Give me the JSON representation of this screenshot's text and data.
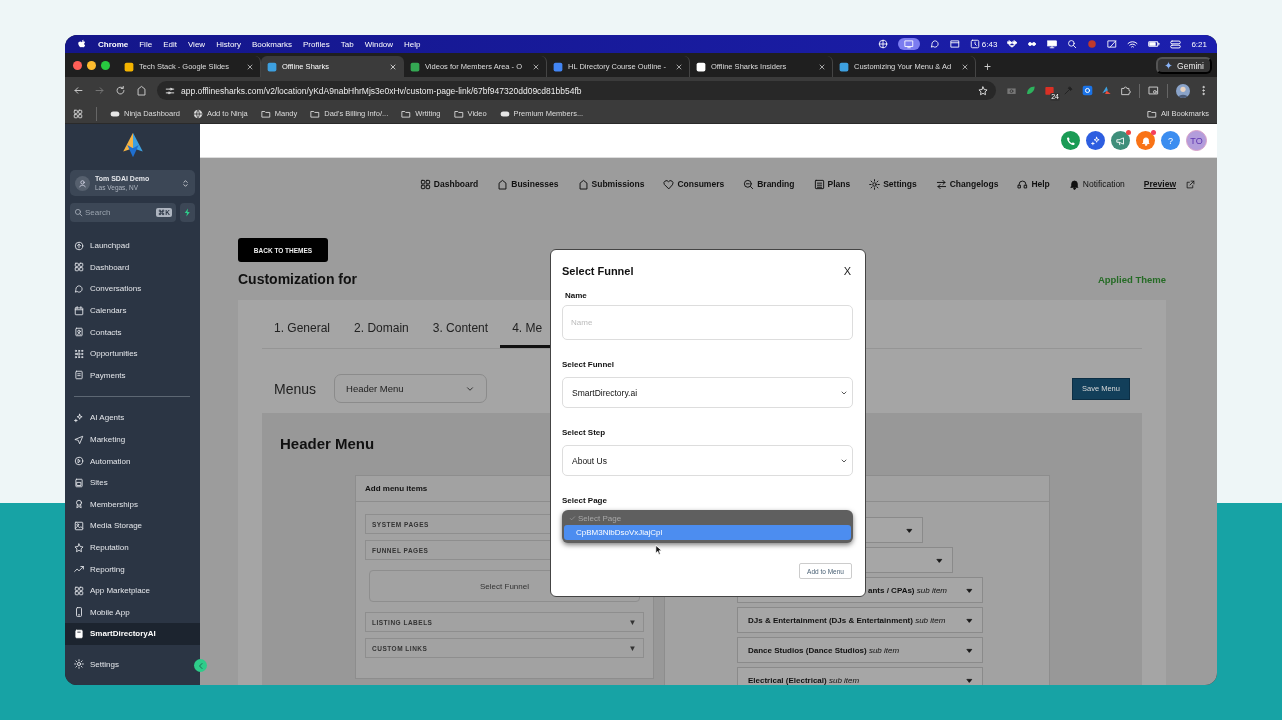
{
  "menubar": {
    "app": "Chrome",
    "menus": [
      "File",
      "Edit",
      "View",
      "History",
      "Bookmarks",
      "Profiles",
      "Tab",
      "Window",
      "Help"
    ],
    "timer": "6:43",
    "clock": "6:21"
  },
  "browser": {
    "tabs": [
      {
        "title": "Tech Stack - Google Slides",
        "selected": false
      },
      {
        "title": "Offline Sharks",
        "selected": true
      },
      {
        "title": "Videos for Members Area - O",
        "selected": false
      },
      {
        "title": "HL Directory Course Outline -",
        "selected": false
      },
      {
        "title": "Offline Sharks Insiders",
        "selected": false
      },
      {
        "title": "Customizing Your Menu & Ad",
        "selected": false
      }
    ],
    "new_tab": "+",
    "gemini": "Gemini",
    "url": "app.offlinesharks.com/v2/location/yKdA9nabHhrMjs3e0xHv/custom-page-link/67bf947320dd09cd81bb54fb",
    "calendar_badge": "24",
    "bookmarks": [
      {
        "label": "Ninja Dashboard",
        "kind": "favicon"
      },
      {
        "label": "Add to Ninja",
        "kind": "globe"
      },
      {
        "label": "Mandy",
        "kind": "folder"
      },
      {
        "label": "Dad's Billing Info/...",
        "kind": "folder"
      },
      {
        "label": "Wrtiting",
        "kind": "folder"
      },
      {
        "label": "Video",
        "kind": "folder"
      },
      {
        "label": "Premium Members...",
        "kind": "favicon"
      }
    ],
    "all_bookmarks": "All Bookmarks"
  },
  "sidebar": {
    "account": {
      "name": "Tom SDAI Demo",
      "location": "Las Vegas, NV"
    },
    "search": {
      "placeholder": "Search",
      "shortcut": "⌘K"
    },
    "groups": [
      {
        "items": [
          {
            "label": "Launchpad",
            "selected": false
          },
          {
            "label": "Dashboard",
            "selected": false
          },
          {
            "label": "Conversations",
            "selected": false
          },
          {
            "label": "Calendars",
            "selected": false
          },
          {
            "label": "Contacts",
            "selected": false
          },
          {
            "label": "Opportunities",
            "selected": false
          },
          {
            "label": "Payments",
            "selected": false
          }
        ]
      },
      {
        "items": [
          {
            "label": "AI Agents",
            "selected": false
          },
          {
            "label": "Marketing",
            "selected": false
          },
          {
            "label": "Automation",
            "selected": false
          },
          {
            "label": "Sites",
            "selected": false
          },
          {
            "label": "Memberships",
            "selected": false
          },
          {
            "label": "Media Storage",
            "selected": false
          },
          {
            "label": "Reputation",
            "selected": false
          },
          {
            "label": "Reporting",
            "selected": false
          },
          {
            "label": "App Marketplace",
            "selected": false
          },
          {
            "label": "Mobile App",
            "selected": false
          },
          {
            "label": "SmartDirectoryAI",
            "selected": true
          }
        ]
      }
    ],
    "footer": {
      "label": "Settings"
    }
  },
  "topbar": {
    "help": "?",
    "avatar": "TO"
  },
  "nav": {
    "items": [
      {
        "label": "Dashboard",
        "kind": "bold"
      },
      {
        "label": "Businesses",
        "kind": "bold"
      },
      {
        "label": "Submissions",
        "kind": "bold"
      },
      {
        "label": "Consumers",
        "kind": "bold"
      },
      {
        "label": "Branding",
        "kind": "bold"
      },
      {
        "label": "Plans",
        "kind": "bold"
      },
      {
        "label": "Settings",
        "kind": "bold"
      },
      {
        "label": "Changelogs",
        "kind": "bold"
      },
      {
        "label": "Help",
        "kind": "bold"
      },
      {
        "label": "Notification",
        "kind": "plain"
      },
      {
        "label": "Preview",
        "kind": "link"
      }
    ]
  },
  "page": {
    "back_button": "BACK TO THEMES",
    "title": "Customization for",
    "status": "Applied Theme",
    "tabs": [
      {
        "label": "1. General",
        "selected": false
      },
      {
        "label": "2. Domain",
        "selected": false
      },
      {
        "label": "3. Content",
        "selected": false
      },
      {
        "label": "4. Me",
        "selected": true
      }
    ],
    "menus_label": "Menus",
    "menu_select": "Header Menu",
    "save_button": "Save Menu",
    "section_title": "Header Menu",
    "add_panel": {
      "title": "Add menu items",
      "sections": [
        {
          "label": "SYSTEM PAGES",
          "kind": "section"
        },
        {
          "label": "FUNNEL PAGES",
          "kind": "section"
        },
        {
          "label": "Select Funnel",
          "kind": "button"
        },
        {
          "label": "LISTING LABELS",
          "kind": "section",
          "arrow": "▼"
        },
        {
          "label": "CUSTOM LINKS",
          "kind": "section",
          "arrow": "▼"
        }
      ]
    },
    "menu_rows": [
      {
        "children": [
          {
            "children": [
              {
                "label": "**ants / CPAs)** *sub item*"
              },
              {
                "label": "**DJs & Entertainment (DJs & Entertainment)** *sub item*"
              },
              {
                "label": "**Dance Studios (Dance Studios)** *sub item*"
              },
              {
                "label": "**Electrical (Electrical)** *sub item*"
              }
            ]
          }
        ]
      }
    ]
  },
  "modal": {
    "title": "Select Funnel",
    "close": "X",
    "fields": [
      {
        "label": "Name",
        "kind": "input",
        "placeholder": "Name"
      },
      {
        "label": "Select Funnel",
        "kind": "select",
        "value": "SmartDirectory.ai"
      },
      {
        "label": "Select Step",
        "kind": "select",
        "value": "About Us"
      },
      {
        "label": "Select Page",
        "kind": "dropdown",
        "options": [
          {
            "label": "Select Page",
            "checked": true,
            "disabled": true,
            "selected": false
          },
          {
            "label": "CpBM3NlbDsoVxJiajCpl",
            "checked": false,
            "disabled": false,
            "selected": true
          }
        ]
      }
    ],
    "button": "Add to Menu"
  }
}
